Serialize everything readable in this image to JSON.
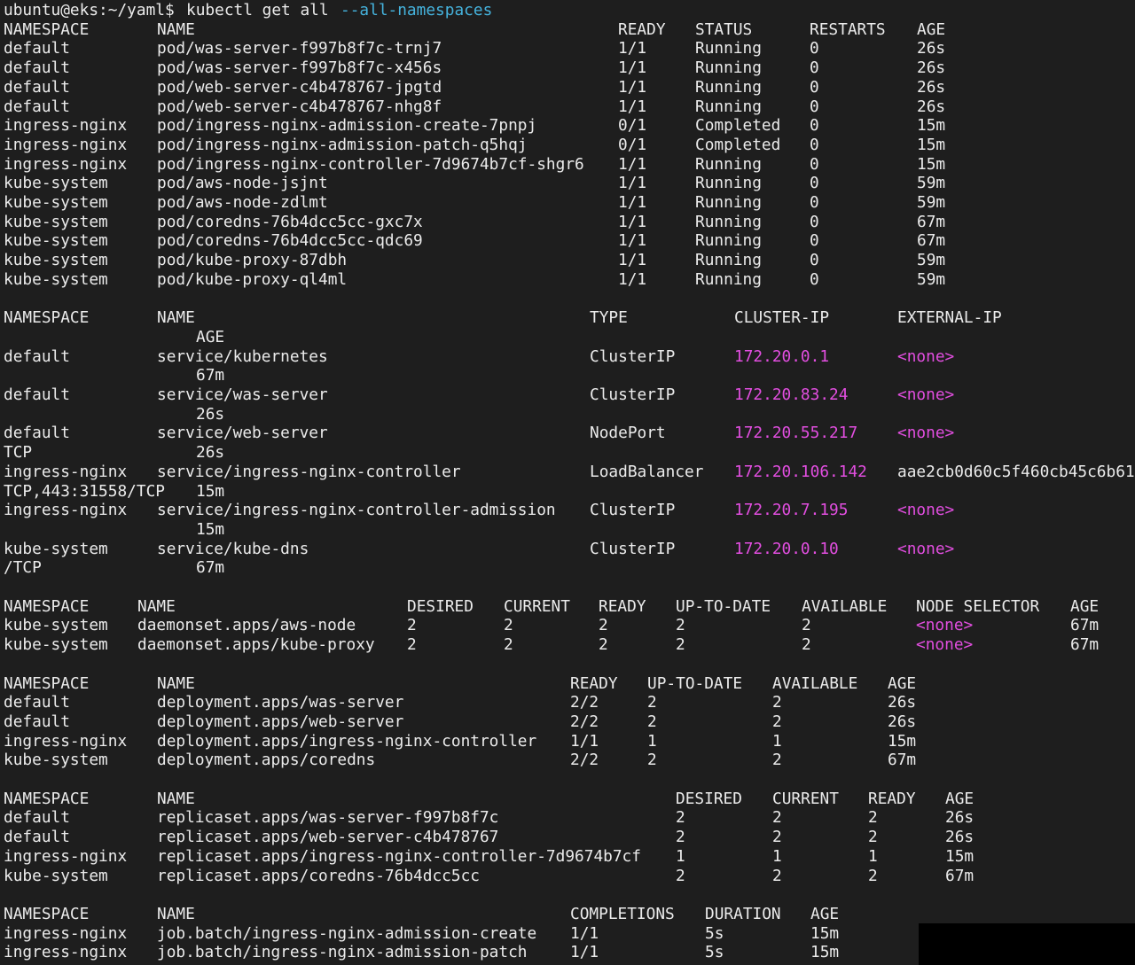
{
  "terminal": {
    "prompt": "ubuntu@eks:~/yaml$",
    "command": "kubectl get all",
    "command_flag": "--all-namespaces",
    "colors": {
      "background": "#1e1e1e",
      "text": "#ebebeb",
      "flag": "#45b2dc",
      "ip": "#e24ee0"
    }
  },
  "pods": {
    "headers": [
      "NAMESPACE",
      "NAME",
      "READY",
      "STATUS",
      "RESTARTS",
      "AGE"
    ],
    "rows": [
      [
        "default",
        "pod/was-server-f997b8f7c-trnj7",
        "1/1",
        "Running",
        "0",
        "26s"
      ],
      [
        "default",
        "pod/was-server-f997b8f7c-x456s",
        "1/1",
        "Running",
        "0",
        "26s"
      ],
      [
        "default",
        "pod/web-server-c4b478767-jpgtd",
        "1/1",
        "Running",
        "0",
        "26s"
      ],
      [
        "default",
        "pod/web-server-c4b478767-nhg8f",
        "1/1",
        "Running",
        "0",
        "26s"
      ],
      [
        "ingress-nginx",
        "pod/ingress-nginx-admission-create-7pnpj",
        "0/1",
        "Completed",
        "0",
        "15m"
      ],
      [
        "ingress-nginx",
        "pod/ingress-nginx-admission-patch-q5hqj",
        "0/1",
        "Completed",
        "0",
        "15m"
      ],
      [
        "ingress-nginx",
        "pod/ingress-nginx-controller-7d9674b7cf-shgr6",
        "1/1",
        "Running",
        "0",
        "15m"
      ],
      [
        "kube-system",
        "pod/aws-node-jsjnt",
        "1/1",
        "Running",
        "0",
        "59m"
      ],
      [
        "kube-system",
        "pod/aws-node-zdlmt",
        "1/1",
        "Running",
        "0",
        "59m"
      ],
      [
        "kube-system",
        "pod/coredns-76b4dcc5cc-gxc7x",
        "1/1",
        "Running",
        "0",
        "67m"
      ],
      [
        "kube-system",
        "pod/coredns-76b4dcc5cc-qdc69",
        "1/1",
        "Running",
        "0",
        "67m"
      ],
      [
        "kube-system",
        "pod/kube-proxy-87dbh",
        "1/1",
        "Running",
        "0",
        "59m"
      ],
      [
        "kube-system",
        "pod/kube-proxy-ql4ml",
        "1/1",
        "Running",
        "0",
        "59m"
      ]
    ]
  },
  "services": {
    "headers": [
      "NAMESPACE",
      "NAME",
      "TYPE",
      "CLUSTER-IP",
      "EXTERNAL-IP"
    ],
    "age_header": "AGE",
    "rows": [
      {
        "namespace": "default",
        "name": "service/kubernetes",
        "type": "ClusterIP",
        "cluster_ip": "172.20.0.1",
        "external_ip": "<none>",
        "wrap_prefix": "",
        "age": "67m"
      },
      {
        "namespace": "default",
        "name": "service/was-server",
        "type": "ClusterIP",
        "cluster_ip": "172.20.83.24",
        "external_ip": "<none>",
        "wrap_prefix": "",
        "age": "26s"
      },
      {
        "namespace": "default",
        "name": "service/web-server",
        "type": "NodePort",
        "cluster_ip": "172.20.55.217",
        "external_ip": "<none>",
        "wrap_prefix": "TCP",
        "age": "26s"
      },
      {
        "namespace": "ingress-nginx",
        "name": "service/ingress-nginx-controller",
        "type": "LoadBalancer",
        "cluster_ip": "172.20.106.142",
        "external_ip": "aae2cb0d60c5f460cb45c6b61",
        "wrap_prefix": "TCP,443:31558/TCP",
        "age": "15m"
      },
      {
        "namespace": "ingress-nginx",
        "name": "service/ingress-nginx-controller-admission",
        "type": "ClusterIP",
        "cluster_ip": "172.20.7.195",
        "external_ip": "<none>",
        "wrap_prefix": "",
        "age": "15m"
      },
      {
        "namespace": "kube-system",
        "name": "service/kube-dns",
        "type": "ClusterIP",
        "cluster_ip": "172.20.0.10",
        "external_ip": "<none>",
        "wrap_prefix": "/TCP",
        "age": "67m"
      }
    ]
  },
  "daemonsets": {
    "headers": [
      "NAMESPACE",
      "NAME",
      "DESIRED",
      "CURRENT",
      "READY",
      "UP-TO-DATE",
      "AVAILABLE",
      "NODE SELECTOR",
      "AGE"
    ],
    "rows": [
      [
        "kube-system",
        "daemonset.apps/aws-node",
        "2",
        "2",
        "2",
        "2",
        "2",
        "<none>",
        "67m"
      ],
      [
        "kube-system",
        "daemonset.apps/kube-proxy",
        "2",
        "2",
        "2",
        "2",
        "2",
        "<none>",
        "67m"
      ]
    ]
  },
  "deployments": {
    "headers": [
      "NAMESPACE",
      "NAME",
      "READY",
      "UP-TO-DATE",
      "AVAILABLE",
      "AGE"
    ],
    "rows": [
      [
        "default",
        "deployment.apps/was-server",
        "2/2",
        "2",
        "2",
        "26s"
      ],
      [
        "default",
        "deployment.apps/web-server",
        "2/2",
        "2",
        "2",
        "26s"
      ],
      [
        "ingress-nginx",
        "deployment.apps/ingress-nginx-controller",
        "1/1",
        "1",
        "1",
        "15m"
      ],
      [
        "kube-system",
        "deployment.apps/coredns",
        "2/2",
        "2",
        "2",
        "67m"
      ]
    ]
  },
  "replicasets": {
    "headers": [
      "NAMESPACE",
      "NAME",
      "DESIRED",
      "CURRENT",
      "READY",
      "AGE"
    ],
    "rows": [
      [
        "default",
        "replicaset.apps/was-server-f997b8f7c",
        "2",
        "2",
        "2",
        "26s"
      ],
      [
        "default",
        "replicaset.apps/web-server-c4b478767",
        "2",
        "2",
        "2",
        "26s"
      ],
      [
        "ingress-nginx",
        "replicaset.apps/ingress-nginx-controller-7d9674b7cf",
        "1",
        "1",
        "1",
        "15m"
      ],
      [
        "kube-system",
        "replicaset.apps/coredns-76b4dcc5cc",
        "2",
        "2",
        "2",
        "67m"
      ]
    ]
  },
  "jobs": {
    "headers": [
      "NAMESPACE",
      "NAME",
      "COMPLETIONS",
      "DURATION",
      "AGE"
    ],
    "rows": [
      [
        "ingress-nginx",
        "job.batch/ingress-nginx-admission-create",
        "1/1",
        "5s",
        "15m"
      ],
      [
        "ingress-nginx",
        "job.batch/ingress-nginx-admission-patch",
        "1/1",
        "5s",
        "15m"
      ]
    ]
  }
}
